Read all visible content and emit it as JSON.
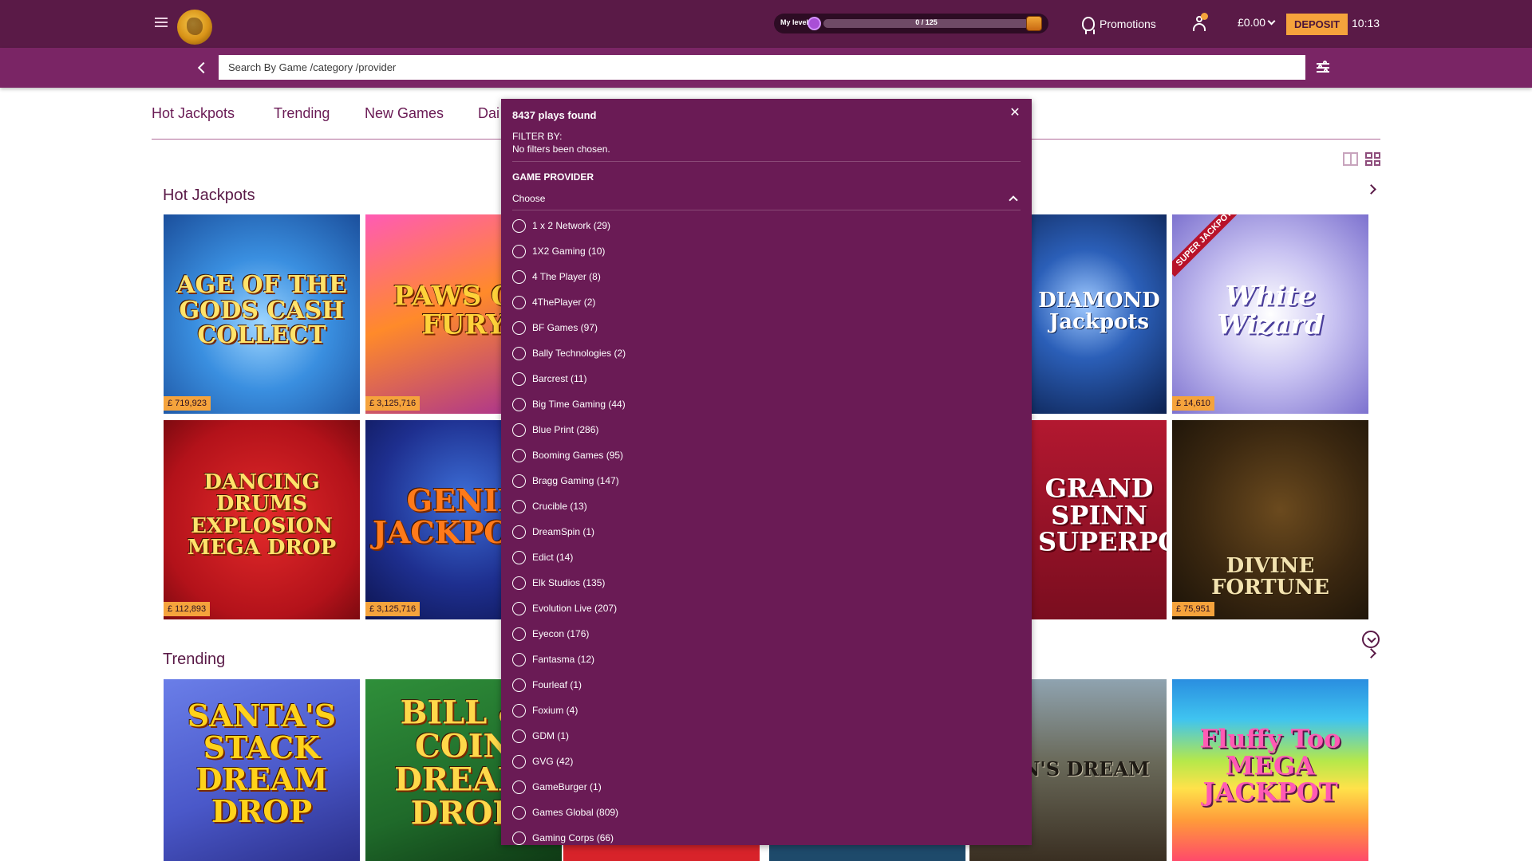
{
  "header": {
    "level_label": "My level",
    "level_progress_text": "0 / 125",
    "level_progress_fraction": 0,
    "promotions_label": "Promotions",
    "balance": "£0.00",
    "deposit_label": "DEPOSIT",
    "time": "10:13"
  },
  "search": {
    "placeholder": "Search By Game /category /provider"
  },
  "tabs": [
    "Hot Jackpots",
    "Trending",
    "New Games",
    "Dai"
  ],
  "sections": {
    "hot_jackpots": {
      "title": "Hot Jackpots",
      "tiles": [
        {
          "name": "AGE OF THE GODS CASH COLLECT",
          "jackpot": "£ 719,923"
        },
        {
          "name": "PAWS OF FURY",
          "jackpot": "£ 3,125,716"
        },
        {
          "name": "DIAMOND Jackpots",
          "jackpot": ""
        },
        {
          "name": "White Wizard",
          "badge": "SUPER JACKPOT",
          "jackpot": "£ 14,610"
        },
        {
          "name": "DANCING DRUMS EXPLOSION MEGA DROP",
          "jackpot": "£ 112,893"
        },
        {
          "name": "GENIE JACKPOTS",
          "jackpot": "£ 3,125,716"
        },
        {
          "name": "GRAND SPINN SUPERPOT",
          "jackpot": ""
        },
        {
          "name": "DIVINE FORTUNE",
          "jackpot": "£ 75,951"
        }
      ]
    },
    "trending": {
      "title": "Trending",
      "tiles": [
        {
          "name": "SANTA'S STACK DREAM DROP"
        },
        {
          "name": "BILL & COIN DREAM DROP"
        },
        {
          "name": "MAN'S DREAM"
        },
        {
          "name": "Fluffy Too MEGA JACKPOT"
        }
      ]
    }
  },
  "filter_panel": {
    "count_text": "8437 plays found",
    "filter_by_label": "FILTER BY:",
    "no_filters_text": "No filters been chosen.",
    "provider_heading": "GAME PROVIDER",
    "choose_label": "Choose",
    "close_glyph": "✕",
    "providers": [
      "1 x 2 Network (29)",
      "1X2 Gaming (10)",
      "4 The Player (8)",
      "4ThePlayer (2)",
      "BF Games (97)",
      "Bally Technologies (2)",
      "Barcrest (11)",
      "Big Time Gaming (44)",
      "Blue Print (286)",
      "Booming Games (95)",
      "Bragg Gaming (147)",
      "Crucible (13)",
      "DreamSpin (1)",
      "Edict (14)",
      "Elk Studios (135)",
      "Evolution Live (207)",
      "Eyecon (176)",
      "Fantasma (12)",
      "Fourleaf (1)",
      "Foxium (4)",
      "GDM (1)",
      "GVG (42)",
      "GameBurger (1)",
      "Games Global (809)",
      "Gaming Corps (66)"
    ]
  },
  "colors": {
    "header_bg": "#5a1a47",
    "search_bg": "#7a2565",
    "panel_bg": "#6a1b55",
    "accent": "#f5a33c"
  }
}
